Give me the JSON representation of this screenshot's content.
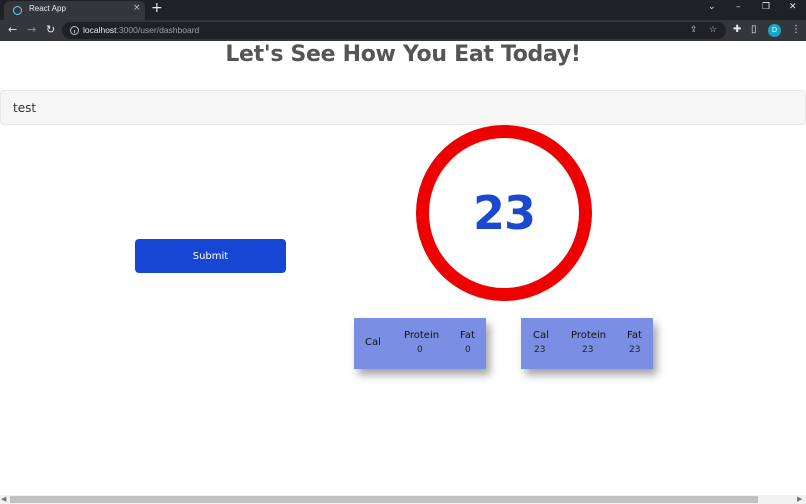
{
  "browser": {
    "tab_title": "React App",
    "tab_close": "×",
    "new_tab": "+",
    "controls": {
      "dropdown": "⌄",
      "minimize": "–",
      "restore": "❐",
      "close": "✕"
    },
    "nav": {
      "back": "←",
      "forward": "→",
      "reload": "↻"
    },
    "url_host": "localhost",
    "url_path": ":3000/user/dashboard",
    "profile_initial": "D",
    "icons": {
      "share": "⇪",
      "star": "☆",
      "extensions": "✚",
      "sidepanel": "▯",
      "menu": "⋮"
    }
  },
  "page": {
    "title": "Let's See How You Eat Today!",
    "input_value": "test",
    "submit_label": "Submit",
    "ring_value": "23",
    "ring_color": "#ee0000",
    "accent": "#1746d4",
    "card_color": "#7a8fe3"
  },
  "cards": [
    {
      "cal_label": "Cal",
      "protein_label": "Protein",
      "fat_label": "Fat",
      "cal_value": "",
      "protein_value": "0",
      "fat_value": "0"
    },
    {
      "cal_label": "Cal",
      "protein_label": "Protein",
      "fat_label": "Fat",
      "cal_value": "23",
      "protein_value": "23",
      "fat_value": "23"
    }
  ],
  "scrollbar": {
    "left_arrow": "◀",
    "right_arrow": "▶"
  }
}
